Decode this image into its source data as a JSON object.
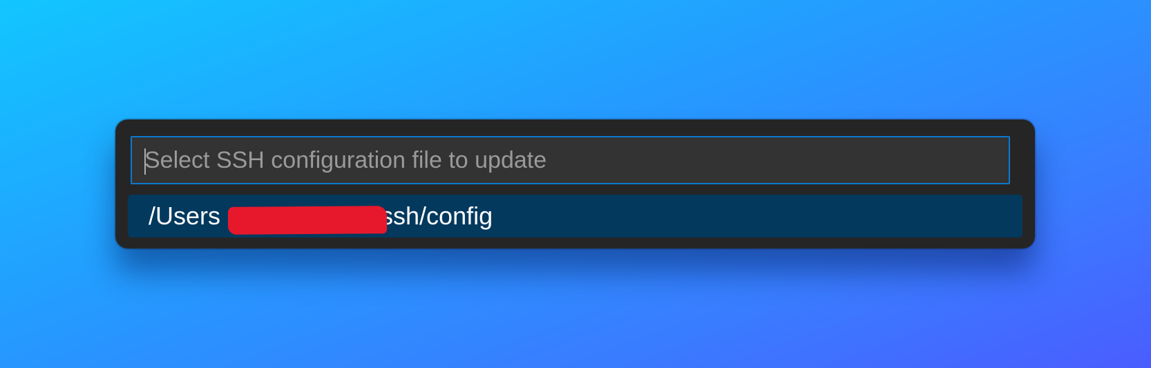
{
  "quick_pick": {
    "input": {
      "placeholder": "Select SSH configuration file to update",
      "value": ""
    },
    "items": [
      {
        "label_prefix": "/Users",
        "label_suffix": ".ssh/config",
        "selected": true
      }
    ]
  },
  "colors": {
    "panel_background": "#252526",
    "input_background": "#333333",
    "focus_border": "#0a7ad0",
    "selected_item_background": "#04395e",
    "redaction": "#e8182c"
  }
}
